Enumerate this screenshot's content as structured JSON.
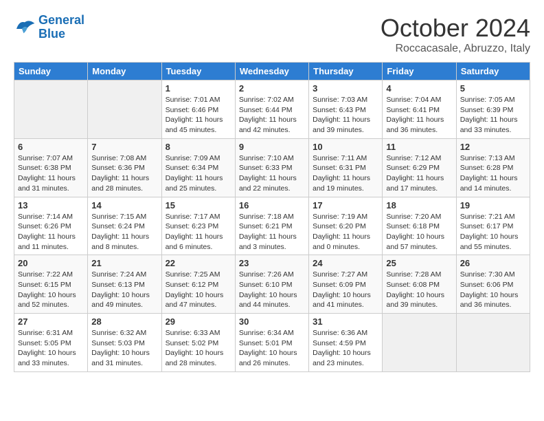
{
  "header": {
    "logo": {
      "line1": "General",
      "line2": "Blue"
    },
    "month": "October 2024",
    "location": "Roccacasale, Abruzzo, Italy"
  },
  "weekdays": [
    "Sunday",
    "Monday",
    "Tuesday",
    "Wednesday",
    "Thursday",
    "Friday",
    "Saturday"
  ],
  "weeks": [
    {
      "days": [
        {
          "number": "",
          "empty": true
        },
        {
          "number": "",
          "empty": true
        },
        {
          "number": "1",
          "sunrise": "Sunrise: 7:01 AM",
          "sunset": "Sunset: 6:46 PM",
          "daylight": "Daylight: 11 hours and 45 minutes."
        },
        {
          "number": "2",
          "sunrise": "Sunrise: 7:02 AM",
          "sunset": "Sunset: 6:44 PM",
          "daylight": "Daylight: 11 hours and 42 minutes."
        },
        {
          "number": "3",
          "sunrise": "Sunrise: 7:03 AM",
          "sunset": "Sunset: 6:43 PM",
          "daylight": "Daylight: 11 hours and 39 minutes."
        },
        {
          "number": "4",
          "sunrise": "Sunrise: 7:04 AM",
          "sunset": "Sunset: 6:41 PM",
          "daylight": "Daylight: 11 hours and 36 minutes."
        },
        {
          "number": "5",
          "sunrise": "Sunrise: 7:05 AM",
          "sunset": "Sunset: 6:39 PM",
          "daylight": "Daylight: 11 hours and 33 minutes."
        }
      ]
    },
    {
      "days": [
        {
          "number": "6",
          "sunrise": "Sunrise: 7:07 AM",
          "sunset": "Sunset: 6:38 PM",
          "daylight": "Daylight: 11 hours and 31 minutes."
        },
        {
          "number": "7",
          "sunrise": "Sunrise: 7:08 AM",
          "sunset": "Sunset: 6:36 PM",
          "daylight": "Daylight: 11 hours and 28 minutes."
        },
        {
          "number": "8",
          "sunrise": "Sunrise: 7:09 AM",
          "sunset": "Sunset: 6:34 PM",
          "daylight": "Daylight: 11 hours and 25 minutes."
        },
        {
          "number": "9",
          "sunrise": "Sunrise: 7:10 AM",
          "sunset": "Sunset: 6:33 PM",
          "daylight": "Daylight: 11 hours and 22 minutes."
        },
        {
          "number": "10",
          "sunrise": "Sunrise: 7:11 AM",
          "sunset": "Sunset: 6:31 PM",
          "daylight": "Daylight: 11 hours and 19 minutes."
        },
        {
          "number": "11",
          "sunrise": "Sunrise: 7:12 AM",
          "sunset": "Sunset: 6:29 PM",
          "daylight": "Daylight: 11 hours and 17 minutes."
        },
        {
          "number": "12",
          "sunrise": "Sunrise: 7:13 AM",
          "sunset": "Sunset: 6:28 PM",
          "daylight": "Daylight: 11 hours and 14 minutes."
        }
      ]
    },
    {
      "days": [
        {
          "number": "13",
          "sunrise": "Sunrise: 7:14 AM",
          "sunset": "Sunset: 6:26 PM",
          "daylight": "Daylight: 11 hours and 11 minutes."
        },
        {
          "number": "14",
          "sunrise": "Sunrise: 7:15 AM",
          "sunset": "Sunset: 6:24 PM",
          "daylight": "Daylight: 11 hours and 8 minutes."
        },
        {
          "number": "15",
          "sunrise": "Sunrise: 7:17 AM",
          "sunset": "Sunset: 6:23 PM",
          "daylight": "Daylight: 11 hours and 6 minutes."
        },
        {
          "number": "16",
          "sunrise": "Sunrise: 7:18 AM",
          "sunset": "Sunset: 6:21 PM",
          "daylight": "Daylight: 11 hours and 3 minutes."
        },
        {
          "number": "17",
          "sunrise": "Sunrise: 7:19 AM",
          "sunset": "Sunset: 6:20 PM",
          "daylight": "Daylight: 11 hours and 0 minutes."
        },
        {
          "number": "18",
          "sunrise": "Sunrise: 7:20 AM",
          "sunset": "Sunset: 6:18 PM",
          "daylight": "Daylight: 10 hours and 57 minutes."
        },
        {
          "number": "19",
          "sunrise": "Sunrise: 7:21 AM",
          "sunset": "Sunset: 6:17 PM",
          "daylight": "Daylight: 10 hours and 55 minutes."
        }
      ]
    },
    {
      "days": [
        {
          "number": "20",
          "sunrise": "Sunrise: 7:22 AM",
          "sunset": "Sunset: 6:15 PM",
          "daylight": "Daylight: 10 hours and 52 minutes."
        },
        {
          "number": "21",
          "sunrise": "Sunrise: 7:24 AM",
          "sunset": "Sunset: 6:13 PM",
          "daylight": "Daylight: 10 hours and 49 minutes."
        },
        {
          "number": "22",
          "sunrise": "Sunrise: 7:25 AM",
          "sunset": "Sunset: 6:12 PM",
          "daylight": "Daylight: 10 hours and 47 minutes."
        },
        {
          "number": "23",
          "sunrise": "Sunrise: 7:26 AM",
          "sunset": "Sunset: 6:10 PM",
          "daylight": "Daylight: 10 hours and 44 minutes."
        },
        {
          "number": "24",
          "sunrise": "Sunrise: 7:27 AM",
          "sunset": "Sunset: 6:09 PM",
          "daylight": "Daylight: 10 hours and 41 minutes."
        },
        {
          "number": "25",
          "sunrise": "Sunrise: 7:28 AM",
          "sunset": "Sunset: 6:08 PM",
          "daylight": "Daylight: 10 hours and 39 minutes."
        },
        {
          "number": "26",
          "sunrise": "Sunrise: 7:30 AM",
          "sunset": "Sunset: 6:06 PM",
          "daylight": "Daylight: 10 hours and 36 minutes."
        }
      ]
    },
    {
      "days": [
        {
          "number": "27",
          "sunrise": "Sunrise: 6:31 AM",
          "sunset": "Sunset: 5:05 PM",
          "daylight": "Daylight: 10 hours and 33 minutes."
        },
        {
          "number": "28",
          "sunrise": "Sunrise: 6:32 AM",
          "sunset": "Sunset: 5:03 PM",
          "daylight": "Daylight: 10 hours and 31 minutes."
        },
        {
          "number": "29",
          "sunrise": "Sunrise: 6:33 AM",
          "sunset": "Sunset: 5:02 PM",
          "daylight": "Daylight: 10 hours and 28 minutes."
        },
        {
          "number": "30",
          "sunrise": "Sunrise: 6:34 AM",
          "sunset": "Sunset: 5:01 PM",
          "daylight": "Daylight: 10 hours and 26 minutes."
        },
        {
          "number": "31",
          "sunrise": "Sunrise: 6:36 AM",
          "sunset": "Sunset: 4:59 PM",
          "daylight": "Daylight: 10 hours and 23 minutes."
        },
        {
          "number": "",
          "empty": true
        },
        {
          "number": "",
          "empty": true
        }
      ]
    }
  ]
}
